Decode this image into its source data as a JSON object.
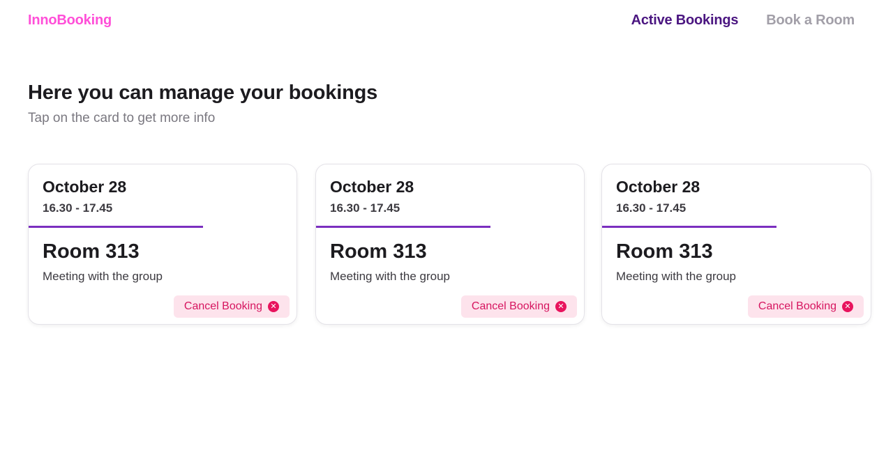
{
  "app": {
    "logo": "InnoBooking"
  },
  "nav": {
    "items": [
      {
        "label": "Active Bookings",
        "active": true
      },
      {
        "label": "Book a Room",
        "active": false
      }
    ]
  },
  "page": {
    "title": "Here you can manage your bookings",
    "subtitle": "Tap on the card to get more info"
  },
  "bookings": [
    {
      "date": "October 28",
      "time": "16.30 - 17.45",
      "room": "Room 313",
      "description": "Meeting with the group",
      "cancel_label": "Cancel Booking",
      "cancel_icon": "close-circle-icon"
    },
    {
      "date": "October 28",
      "time": "16.30 - 17.45",
      "room": "Room 313",
      "description": "Meeting with the group",
      "cancel_label": "Cancel Booking",
      "cancel_icon": "close-circle-icon"
    },
    {
      "date": "October 28",
      "time": "16.30 - 17.45",
      "room": "Room 313",
      "description": "Meeting with the group",
      "cancel_label": "Cancel Booking",
      "cancel_icon": "close-circle-icon"
    }
  ],
  "colors": {
    "logo": "#ff4fd8",
    "nav_active": "#4a1580",
    "nav_inactive": "#a29fa8",
    "accent_divider": "#7b2fbf",
    "cancel_text": "#d6155f",
    "cancel_bg": "#fde3ec"
  }
}
